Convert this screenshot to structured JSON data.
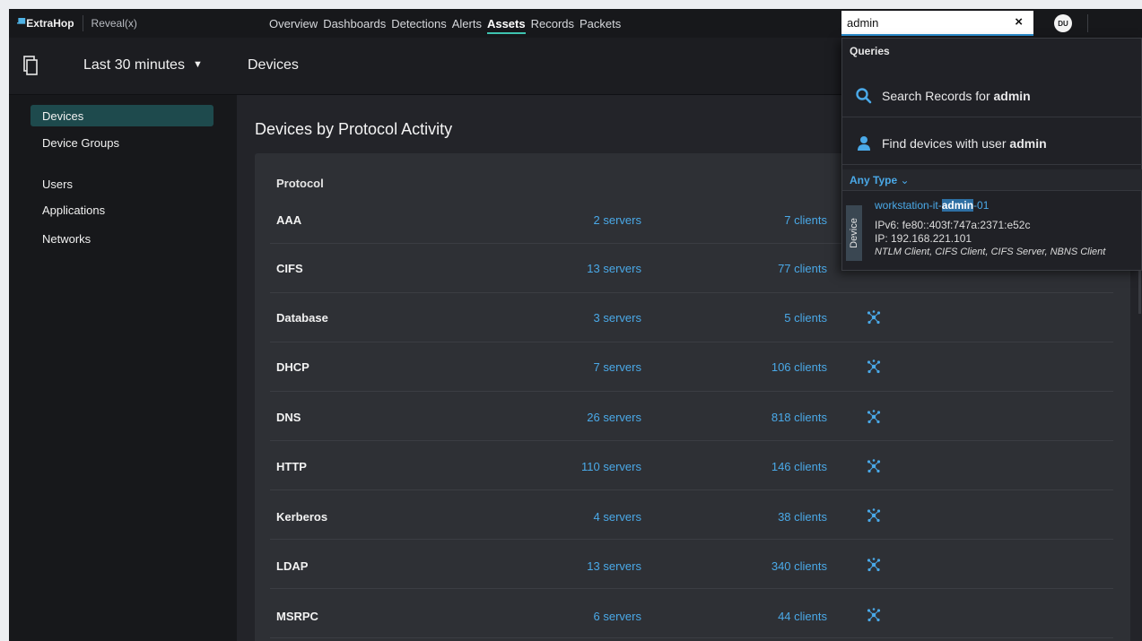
{
  "brand": {
    "name": "ExtraHop",
    "product": "Reveal(x)"
  },
  "nav": [
    {
      "label": "Overview",
      "active": false
    },
    {
      "label": "Dashboards",
      "active": false
    },
    {
      "label": "Detections",
      "active": false
    },
    {
      "label": "Alerts",
      "active": false
    },
    {
      "label": "Assets",
      "active": true
    },
    {
      "label": "Records",
      "active": false
    },
    {
      "label": "Packets",
      "active": false
    }
  ],
  "search": {
    "value": "admin",
    "clear": "×"
  },
  "user": {
    "initials": "DU"
  },
  "time_range": {
    "label": "Last 30 minutes"
  },
  "page": {
    "title": "Devices",
    "section_title": "Devices by Protocol Activity"
  },
  "sidebar": {
    "items": [
      {
        "label": "Devices",
        "active": true
      },
      {
        "label": "Device Groups",
        "active": false
      },
      {
        "label": "Users",
        "active": false
      },
      {
        "label": "Applications",
        "active": false
      },
      {
        "label": "Networks",
        "active": false
      }
    ]
  },
  "table": {
    "column_header": "Protocol",
    "rows": [
      {
        "protocol": "AAA",
        "servers": "2 servers",
        "clients": "7 clients"
      },
      {
        "protocol": "CIFS",
        "servers": "13 servers",
        "clients": "77 clients"
      },
      {
        "protocol": "Database",
        "servers": "3 servers",
        "clients": "5 clients"
      },
      {
        "protocol": "DHCP",
        "servers": "7 servers",
        "clients": "106 clients"
      },
      {
        "protocol": "DNS",
        "servers": "26 servers",
        "clients": "818 clients"
      },
      {
        "protocol": "HTTP",
        "servers": "110 servers",
        "clients": "146 clients"
      },
      {
        "protocol": "Kerberos",
        "servers": "4 servers",
        "clients": "38 clients"
      },
      {
        "protocol": "LDAP",
        "servers": "13 servers",
        "clients": "340 clients"
      },
      {
        "protocol": "MSRPC",
        "servers": "6 servers",
        "clients": "44 clients"
      }
    ]
  },
  "dropdown": {
    "header": "Queries",
    "queries": [
      {
        "prefix": "Search Records for ",
        "term": "admin",
        "icon": "search-icon"
      },
      {
        "prefix": "Find devices with user ",
        "term": "admin",
        "icon": "user-icon"
      }
    ],
    "type_filter": "Any Type",
    "result": {
      "category": "Device",
      "name_before": "workstation-it-",
      "name_match": "admin",
      "name_after": "-01",
      "ipv6": "IPv6: fe80::403f:747a:2371:e52c",
      "ip": "IP: 192.168.221.101",
      "roles": "NTLM Client, CIFS Client, CIFS Server, NBNS Client"
    }
  },
  "colors": {
    "accent": "#4aa9e8",
    "active_tab": "#3ec3b0",
    "active_sidebar": "#1e4a4d",
    "background": "#232429"
  }
}
